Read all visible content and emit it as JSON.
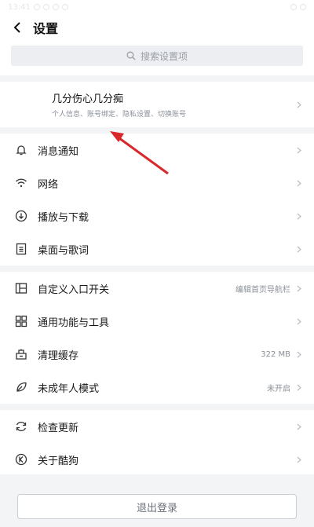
{
  "status": {
    "time": "13:41"
  },
  "header": {
    "title": "设置"
  },
  "search": {
    "placeholder": "搜索设置项"
  },
  "profile": {
    "name": "几分伤心几分痴",
    "subtitle": "个人信息、账号绑定、隐私设置、切换账号"
  },
  "groups": [
    [
      {
        "label": "消息通知",
        "icon": "bell-icon"
      },
      {
        "label": "网络",
        "icon": "wifi-icon"
      },
      {
        "label": "播放与下载",
        "icon": "download-icon"
      },
      {
        "label": "桌面与歌词",
        "icon": "lyrics-icon"
      }
    ],
    [
      {
        "label": "自定义入口开关",
        "value": "编辑首页导航栏",
        "icon": "layout-icon"
      },
      {
        "label": "通用功能与工具",
        "icon": "grid-icon"
      },
      {
        "label": "清理缓存",
        "value": "322 MB",
        "icon": "storage-icon"
      },
      {
        "label": "未成年人模式",
        "value": "未开启",
        "icon": "leaf-icon"
      }
    ],
    [
      {
        "label": "检查更新",
        "icon": "refresh-icon"
      },
      {
        "label": "关于酷狗",
        "icon": "kugou-logo-icon"
      }
    ]
  ],
  "logout": {
    "label": "退出登录"
  }
}
